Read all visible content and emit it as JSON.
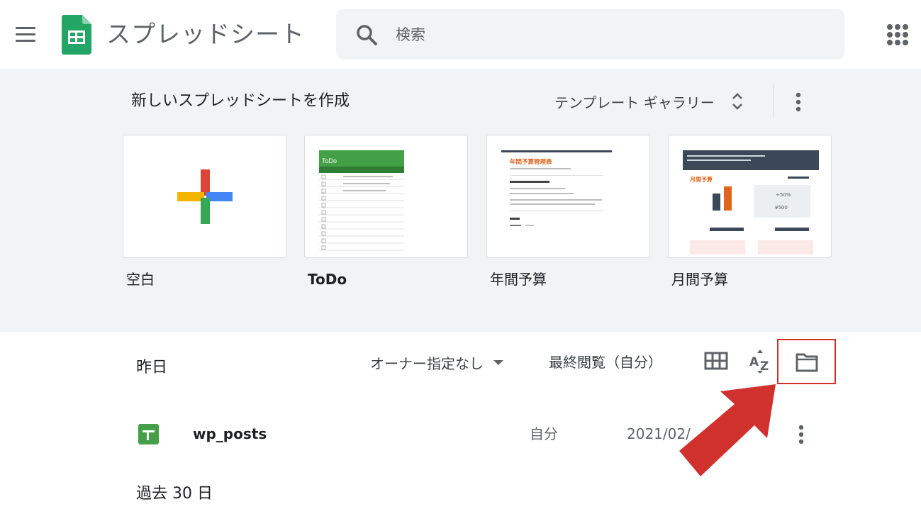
{
  "header": {
    "app_title": "スプレッドシート",
    "search": {
      "placeholder": "検索",
      "value": ""
    },
    "icons": {
      "menu": "hamburger-menu-icon",
      "logo": "sheets-logo",
      "search": "search-icon",
      "apps": "google-apps-icon"
    }
  },
  "gallery": {
    "title": "新しいスプレッドシートを作成",
    "toggle_label": "テンプレート ギャラリー",
    "templates": [
      {
        "label": "空白",
        "thumbnail": "blank-plus"
      },
      {
        "label": "ToDo",
        "thumbnail": "todo-list"
      },
      {
        "label": "年間予算",
        "thumbnail": "annual-budget"
      },
      {
        "label": "月間予算",
        "thumbnail": "monthly-budget"
      }
    ],
    "thumb_text": {
      "todo_title": "ToDo",
      "annual_title": "年間予算管理表",
      "monthly_title": "月間予算",
      "monthly_percent": "+50%",
      "monthly_amount": "¥500"
    }
  },
  "file_list": {
    "section_yesterday": "昨日",
    "owner_filter": "オーナー指定なし",
    "sort_label": "最終閲覧（自分）",
    "view_icons": [
      "grid-view-icon",
      "sort-az-icon",
      "folder-picker-icon"
    ],
    "files": [
      {
        "name": "wp_posts",
        "owner": "自分",
        "date": "2021/02/"
      }
    ],
    "section_30days": "過去 30 日"
  },
  "colors": {
    "sheets_green": "#0f9d58",
    "highlight_red": "#d0312d",
    "gallery_bg": "#f1f3f4"
  }
}
